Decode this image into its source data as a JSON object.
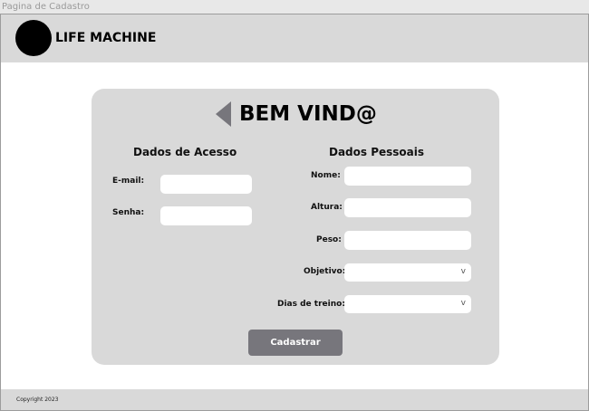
{
  "window": {
    "title": "Pagina de Cadastro"
  },
  "header": {
    "brand": "LIFE MACHINE"
  },
  "card": {
    "title": "BEM VIND@",
    "access": {
      "title": "Dados de Acesso",
      "email_label": "E-mail:",
      "email_value": "",
      "password_label": "Senha:",
      "password_value": ""
    },
    "personal": {
      "title": "Dados Pessoais",
      "name_label": "Nome:",
      "height_label": "Altura:",
      "weight_label": "Peso:",
      "goal_label": "Objetivo:",
      "goal_selected": "",
      "days_label": "Dias de treino:",
      "days_selected": "",
      "chevron": "v"
    },
    "submit_label": "Cadastrar"
  },
  "footer": {
    "copyright": "Copyright 2023"
  },
  "colors": {
    "panel": "#d9d9d9",
    "button": "#77767c",
    "logo": "#000000"
  },
  "icons": {
    "back": "triangle-left-icon",
    "logo": "circle-logo-icon"
  }
}
